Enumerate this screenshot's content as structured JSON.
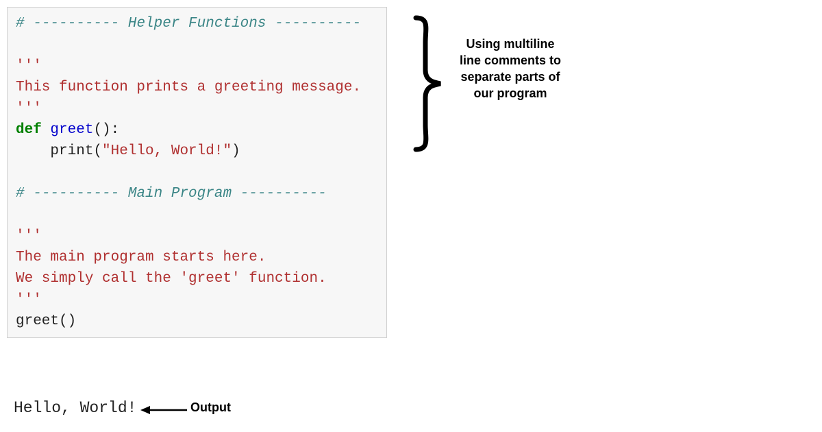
{
  "code": {
    "line1_hash": "# ",
    "line1_dashes_left": "---------- ",
    "line1_text": "Helper Functions",
    "line1_dashes_right": " ----------",
    "line3_triple": "'''",
    "line4_doc": "This function prints a greeting message.",
    "line5_triple": "'''",
    "line6_def": "def",
    "line6_space": " ",
    "line6_fn": "greet",
    "line6_paren": "():",
    "line7_indent": "    print(",
    "line7_str": "\"Hello, World!\"",
    "line7_close": ")",
    "line9_hash": "# ",
    "line9_dashes_left": "---------- ",
    "line9_text": "Main Program",
    "line9_dashes_right": " ----------",
    "line11_triple": "'''",
    "line12_doc": "The main program starts here.",
    "line13_doc": "We simply call the 'greet' function.",
    "line14_triple": "'''",
    "line15_call": "greet()"
  },
  "output": {
    "text": "Hello, World!",
    "label": "Output"
  },
  "annotation": {
    "brace_label": "Using multiline line comments to separate parts of our program"
  }
}
